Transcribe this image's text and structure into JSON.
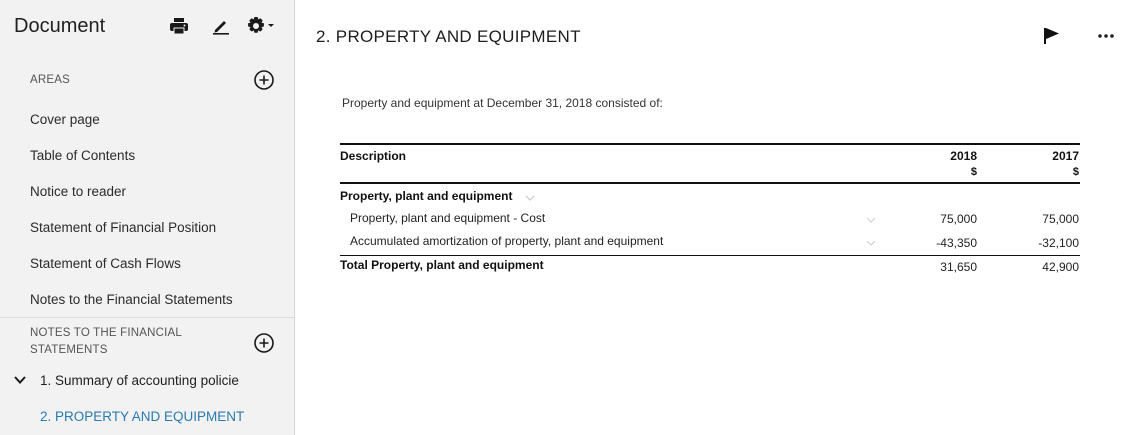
{
  "sidebar": {
    "title": "Document",
    "tools": {
      "print_icon": "print-icon",
      "edit_icon": "pencil-icon",
      "settings_icon": "gear-icon"
    },
    "areas_label": "AREAS",
    "items": [
      {
        "label": "Cover page"
      },
      {
        "label": "Table of Contents"
      },
      {
        "label": "Notice to reader"
      },
      {
        "label": "Statement of Financial Position"
      },
      {
        "label": "Statement of Cash Flows"
      },
      {
        "label": "Notes to the Financial Statements"
      }
    ],
    "notes_section": {
      "line1": "NOTES TO THE FINANCIAL",
      "line2": "STATEMENTS"
    },
    "notes": [
      {
        "label": "1. Summary of accounting policie"
      },
      {
        "label": "2. PROPERTY AND EQUIPMENT"
      }
    ],
    "active_color": "#2a7ab0"
  },
  "main": {
    "title": "2. PROPERTY AND EQUIPMENT",
    "intro": "Property and equipment at December 31, 2018 consisted of:",
    "table": {
      "header": {
        "description": "Description",
        "col1": "2018",
        "col2": "2017",
        "unit1": "$",
        "unit2": "$"
      },
      "group_label": "Property, plant and equipment",
      "rows": [
        {
          "label": "Property, plant and equipment - Cost",
          "v2018": "75,000",
          "v2017": "75,000"
        },
        {
          "label": "Accumulated amortization of property, plant and equipment",
          "v2018": "-43,350",
          "v2017": "-32,100"
        }
      ],
      "total": {
        "label": "Total Property, plant and equipment",
        "v2018": "31,650",
        "v2017": "42,900"
      }
    }
  }
}
